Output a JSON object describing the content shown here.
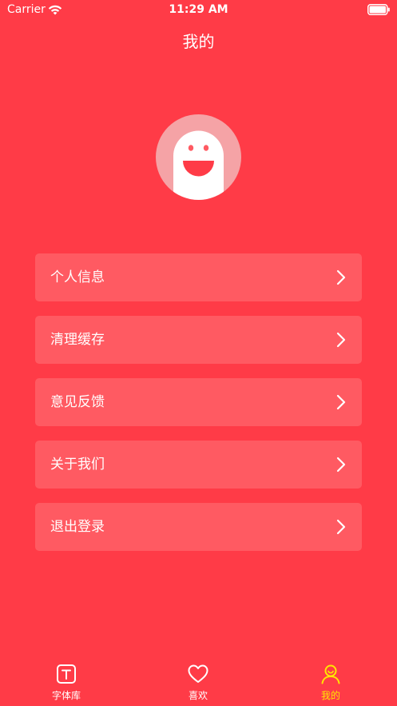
{
  "status_bar": {
    "carrier": "Carrier",
    "time": "11:29 AM"
  },
  "nav": {
    "title": "我的"
  },
  "menu": {
    "items": [
      {
        "label": "个人信息"
      },
      {
        "label": "清理缓存"
      },
      {
        "label": "意见反馈"
      },
      {
        "label": "关于我们"
      },
      {
        "label": "退出登录"
      }
    ]
  },
  "tab_bar": {
    "tabs": [
      {
        "label": "字体库",
        "icon": "font-library-icon",
        "active": false
      },
      {
        "label": "喜欢",
        "icon": "heart-icon",
        "active": false
      },
      {
        "label": "我的",
        "icon": "user-icon",
        "active": true
      }
    ],
    "active_color": "#ffe600"
  },
  "colors": {
    "background": "#ff3b47",
    "menu_item": "#ff5a62",
    "avatar_bg": "#f5a3a6"
  }
}
